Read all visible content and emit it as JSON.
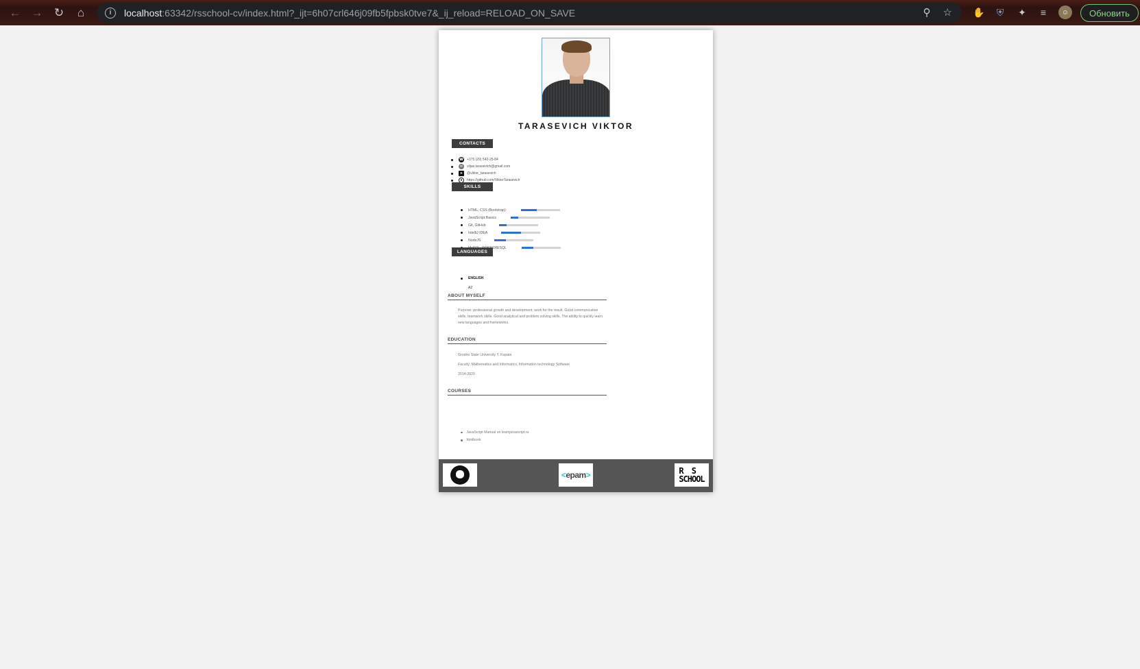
{
  "browser": {
    "url_host": "localhost",
    "url_rest": ":63342/rsschool-cv/index.html?_ijt=6h07crl646j09fb5fpbsk0tve7&_ij_reload=RELOAD_ON_SAVE",
    "update_label": "Обновить"
  },
  "cv": {
    "name": "TARASEVICH VIKTOR",
    "sections": {
      "contacts": "CONTACTS",
      "skills": "SKILLS",
      "languages": "LANGUAGES",
      "about": "ABOUT MYSELF",
      "education": "EDUCATION",
      "courses": "COURSES"
    },
    "contacts": [
      {
        "icon": "phone-icon",
        "text": "+375 (29) 542-25-84"
      },
      {
        "icon": "email-icon",
        "text": "viljas.tarasevich@gmail.com"
      },
      {
        "icon": "telegram-icon",
        "text": "@viktor_tarasevich"
      },
      {
        "icon": "github-icon",
        "text": "https://github.com/ViktorTarasevich"
      }
    ],
    "skills": [
      {
        "name": "HTML, CSS (Bootstrap)",
        "level": 0.4
      },
      {
        "name": "JavaScript Basics",
        "level": 0.2
      },
      {
        "name": "Git, GitHub",
        "level": 0.2
      },
      {
        "name": "IntelliJ IDEA",
        "level": 0.5
      },
      {
        "name": "NodeJS",
        "level": 0.3
      },
      {
        "name": "MySQL, POSTGRESQL",
        "level": 0.3
      }
    ],
    "languages": [
      {
        "name": "ENGLISH",
        "level": "A2"
      }
    ],
    "about": "Purpose: professional growth and development, work for the result. Good communication skills, teamwork skills. Good analytical and problem solving skills. The ability to quickly learn new languages and frameworks.",
    "education": {
      "university": "Grodno State University Y. Kupala",
      "faculty": "Faculty: Mathematics and Informatics, Information technology Software",
      "years": "2014-2020"
    },
    "courses": [
      "JavaScript Manual on learnjavascript.ru",
      "htmlbook"
    ],
    "footer": {
      "epam_text": "epam",
      "rs_line1": "R S",
      "rs_line2": "SCHOOL"
    }
  }
}
